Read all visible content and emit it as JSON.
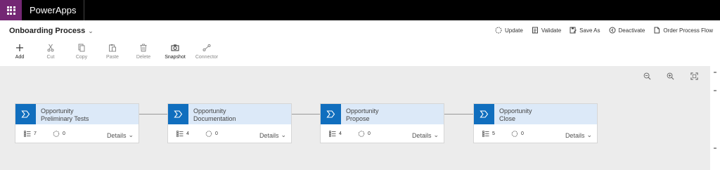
{
  "app": {
    "name": "PowerApps"
  },
  "header": {
    "process_title": "Onboarding Process"
  },
  "actions": [
    {
      "label": "Update",
      "icon": "update-icon"
    },
    {
      "label": "Validate",
      "icon": "validate-icon"
    },
    {
      "label": "Save As",
      "icon": "save-as-icon"
    },
    {
      "label": "Deactivate",
      "icon": "deactivate-icon"
    },
    {
      "label": "Order Process Flow",
      "icon": "order-process-flow-icon"
    }
  ],
  "toolbar": [
    {
      "label": "Add",
      "icon": "plus-icon",
      "enabled": true
    },
    {
      "label": "Cut",
      "icon": "scissors-icon",
      "enabled": false
    },
    {
      "label": "Copy",
      "icon": "copy-icon",
      "enabled": false
    },
    {
      "label": "Paste",
      "icon": "paste-icon",
      "enabled": false
    },
    {
      "label": "Delete",
      "icon": "trash-icon",
      "enabled": false
    },
    {
      "label": "Snapshot",
      "icon": "camera-icon",
      "enabled": true
    },
    {
      "label": "Connector",
      "icon": "connector-icon",
      "enabled": false
    }
  ],
  "stages": [
    {
      "line1": "Opportunity",
      "line2": "Preliminary Tests",
      "steps": "7",
      "conditions": "0",
      "details": "Details"
    },
    {
      "line1": "Opportunity",
      "line2": "Documentation",
      "steps": "4",
      "conditions": "0",
      "details": "Details"
    },
    {
      "line1": "Opportunity",
      "line2": "Propose",
      "steps": "4",
      "conditions": "0",
      "details": "Details"
    },
    {
      "line1": "Opportunity",
      "line2": "Close",
      "steps": "5",
      "conditions": "0",
      "details": "Details"
    }
  ],
  "colors": {
    "accent": "#106ebe",
    "stage_header": "#dce9f8",
    "waffle": "#742774"
  }
}
